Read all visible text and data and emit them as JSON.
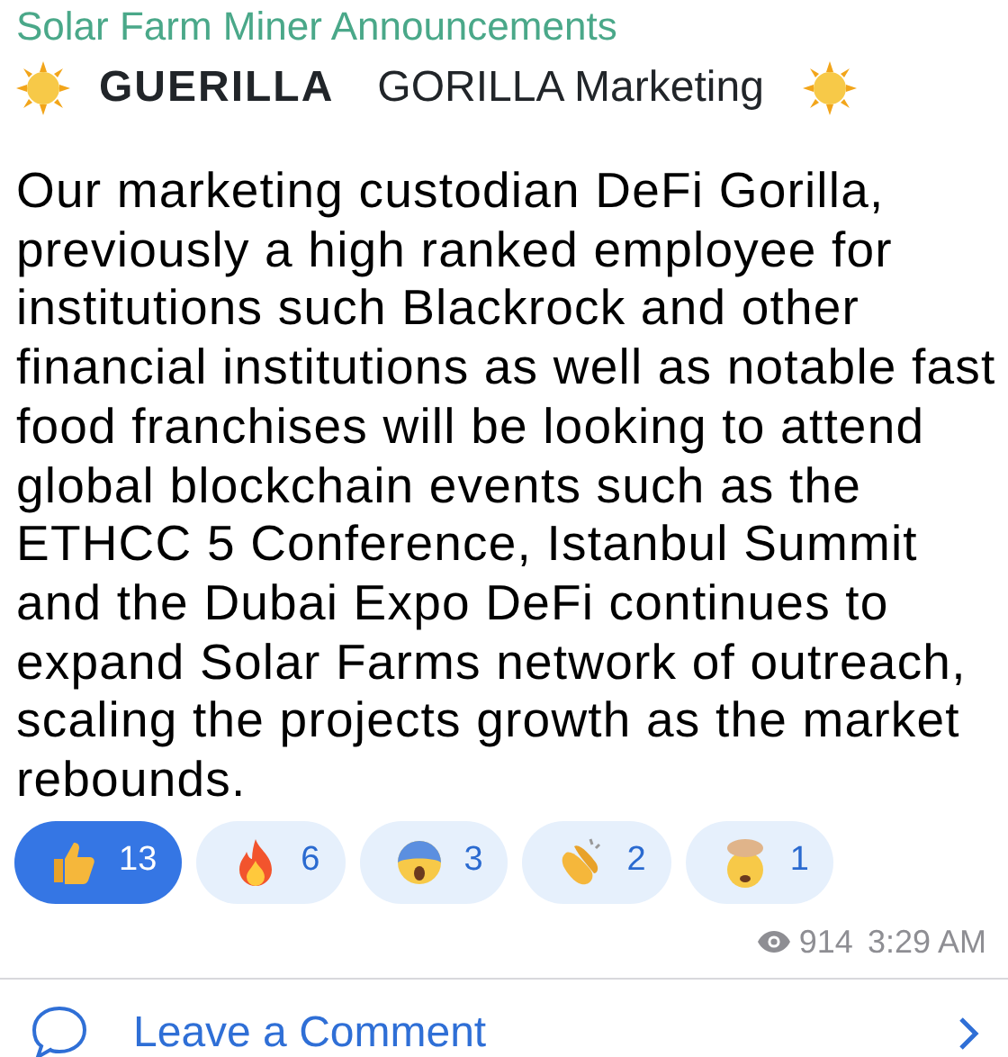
{
  "channel": "Solar Farm Miner Announcements",
  "headline": {
    "logo": "GUERILLA",
    "title": "GORILLA Marketing"
  },
  "body": "Our marketing custodian DeFi Gorilla, previously a high ranked employee for institutions such Blackrock and other financial institutions as well as notable fast food franchises will be looking to attend global blockchain events such as the ETHCC 5 Conference, Istanbul Summit and the Dubai Expo DeFi continues to expand Solar Farms network of outreach, scaling the projects growth as the market rebounds.",
  "reactions": [
    {
      "kind": "thumbs",
      "count": "13",
      "selected": true
    },
    {
      "kind": "fire",
      "count": "6",
      "selected": false
    },
    {
      "kind": "scream",
      "count": "3",
      "selected": false
    },
    {
      "kind": "clap",
      "count": "2",
      "selected": false
    },
    {
      "kind": "mindblown",
      "count": "1",
      "selected": false
    }
  ],
  "views": "914",
  "time": "3:29 AM",
  "comment_link": "Leave a Comment"
}
